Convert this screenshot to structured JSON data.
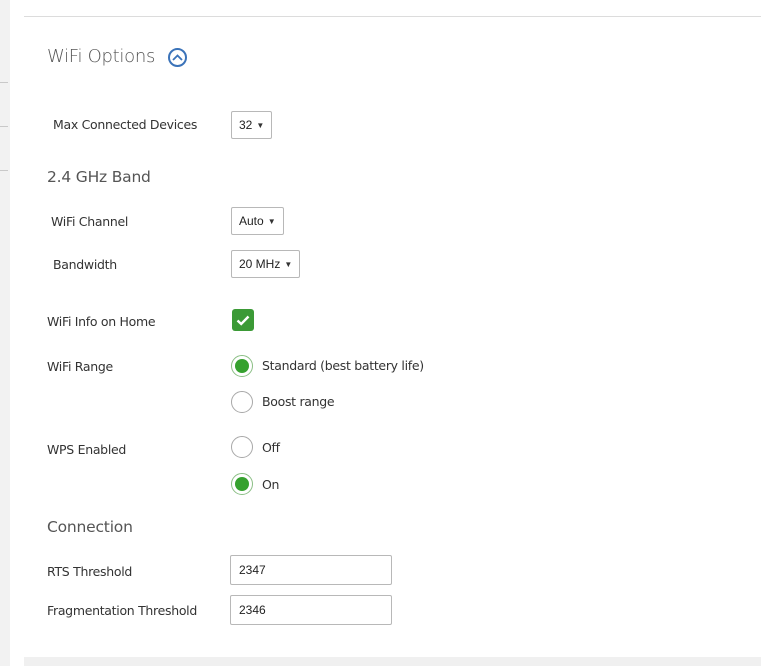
{
  "wifi_options": {
    "title": "WiFi Options",
    "max_connected_devices": {
      "label": "Max Connected Devices",
      "value": "32"
    },
    "band_24": {
      "title": "2.4 GHz Band",
      "channel": {
        "label": "WiFi Channel",
        "value": "Auto"
      },
      "bandwidth": {
        "label": "Bandwidth",
        "value": "20 MHz"
      }
    },
    "wifi_info_on_home": {
      "label": "WiFi Info on Home",
      "checked": true
    },
    "wifi_range": {
      "label": "WiFi Range",
      "options": [
        "Standard (best battery life)",
        "Boost range"
      ],
      "selected": "Standard (best battery life)"
    },
    "wps_enabled": {
      "label": "WPS Enabled",
      "options": [
        "Off",
        "On"
      ],
      "selected": "On"
    }
  },
  "connection": {
    "title": "Connection",
    "rts_threshold": {
      "label": "RTS Threshold",
      "value": "2347"
    },
    "fragmentation_threshold": {
      "label": "Fragmentation Threshold",
      "value": "2346"
    }
  },
  "colors": {
    "accent_blue": "#3b73b9",
    "check_green": "#3b9a36",
    "radio_green": "#35a12e"
  },
  "icons": {
    "collapse": "chevron-up-circle-icon",
    "check": "checkmark-icon"
  }
}
